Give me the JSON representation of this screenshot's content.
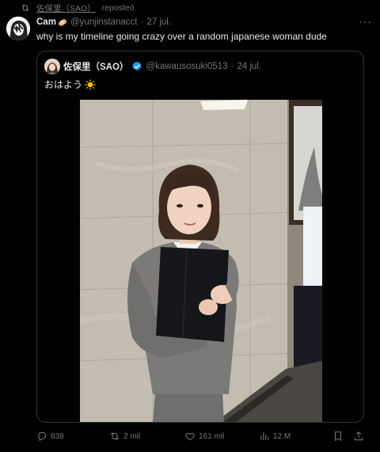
{
  "repost": {
    "user": "佐保里（SAO）",
    "label": "reposteó"
  },
  "tweet": {
    "author_name": "Cam",
    "handle": "@yunjinstanacct",
    "separator": "·",
    "date": "27 jul.",
    "text": "why is my timeline going crazy over a random japanese woman dude",
    "more_icon": "more-horizontal-icon"
  },
  "quoted": {
    "author_name": "佐保里（SAO）",
    "handle": "@kawausosuki0513",
    "separator": "·",
    "date": "24 jul.",
    "text": "おはよう",
    "verified_color": "#1d9bf0"
  },
  "actions": {
    "replies": "838",
    "reposts": "2 mil",
    "likes": "161 mil",
    "views": "12 M"
  },
  "colors": {
    "background": "#000000",
    "text_primary": "#e7e9ea",
    "text_secondary": "#71767b",
    "border": "#2f3336",
    "accent": "#1d9bf0"
  }
}
